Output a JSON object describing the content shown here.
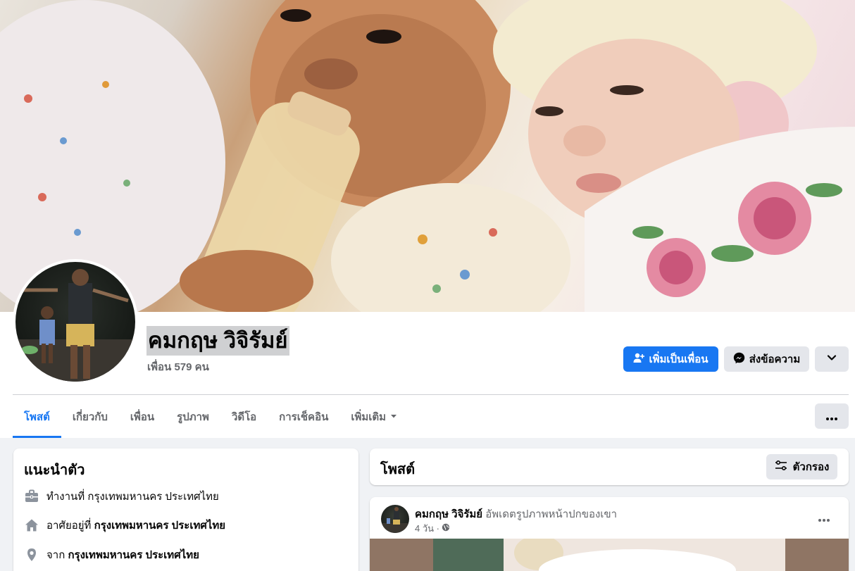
{
  "profile": {
    "name": "คมกฤษ วิจิรัมย์",
    "friends": "เพื่อน 579 คน"
  },
  "actions": {
    "add_friend": "เพิ่มเป็นเพื่อน",
    "message": "ส่งข้อความ"
  },
  "tabs": [
    {
      "label": "โพสต์",
      "active": true
    },
    {
      "label": "เกี่ยวกับ",
      "active": false
    },
    {
      "label": "เพื่อน",
      "active": false
    },
    {
      "label": "รูปภาพ",
      "active": false
    },
    {
      "label": "วิดีโอ",
      "active": false
    },
    {
      "label": "การเช็คอิน",
      "active": false
    },
    {
      "label": "เพิ่มเติม",
      "active": false
    }
  ],
  "intro": {
    "title": "แนะนำตัว",
    "work_prefix": "ทำงานที่ ",
    "work_place": "กรุงเทพมหานคร ประเทศไทย",
    "lives_prefix": "อาศัยอยู่ที่ ",
    "lives_place": "กรุงเทพมหานคร ประเทศไทย",
    "from_prefix": "จาก ",
    "from_place": "กรุงเทพมหานคร ประเทศไทย"
  },
  "posts_section": {
    "title": "โพสต์",
    "filter_label": "ตัวกรอง"
  },
  "post": {
    "author": "คมกฤษ วิจิรัมย์",
    "action": "อัพเดตรูปภาพหน้าปกของเขา",
    "time": "4 วัน ·"
  },
  "colors": {
    "accent": "#1877f2",
    "page_bg": "#f0f2f5",
    "secondary_button": "#e4e6eb",
    "muted_text": "#65676b"
  },
  "icons": {
    "add_friend": "person-plus-icon",
    "message": "messenger-icon",
    "more": "chevron-down-icon",
    "tab_more": "ellipsis-icon",
    "work": "briefcase-icon",
    "home": "home-icon",
    "from": "location-pin-icon",
    "filter": "filter-sliders-icon",
    "privacy": "globe-icon"
  }
}
